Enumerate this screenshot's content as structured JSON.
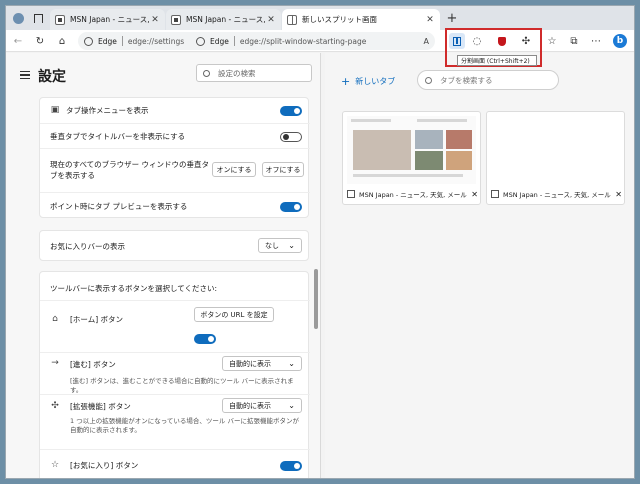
{
  "browser": {
    "tabs": [
      {
        "title": "MSN Japan - ニュース, 天気, メール",
        "active": false
      },
      {
        "title": "MSN Japan - ニュース, 天気, メール",
        "active": false
      },
      {
        "title": "新しいスプリット画面",
        "active": true
      }
    ],
    "new_tab_glyph": "+",
    "address": {
      "left": {
        "host": "Edge",
        "path": "edge://settings"
      },
      "right": {
        "host": "Edge",
        "path": "edge://split-window-starting-page"
      }
    },
    "tooltip": "分割画面 (Ctrl+Shift+2)"
  },
  "settings": {
    "title": "設定",
    "search_placeholder": "設定の検索",
    "tab_options": [
      {
        "label": "タブ操作メニューを表示",
        "state": "on"
      },
      {
        "label": "垂直タブでタイトルバーを非表示にする",
        "state": "off"
      },
      {
        "label": "現在のすべてのブラウザー ウィンドウの垂直タブを表示する",
        "buttons": [
          "オンにする",
          "オフにする"
        ]
      },
      {
        "label": "ポイント時にタブ プレビューを表示する",
        "state": "on"
      }
    ],
    "favorites_bar": {
      "label": "お気に入りバーの表示",
      "value": "なし"
    },
    "toolbar_section": {
      "heading": "ツールバーに表示するボタンを選択してください:",
      "items": [
        {
          "label": "[ホーム] ボタン",
          "button": "ボタンの URL を設定",
          "state": "on"
        },
        {
          "label": "[進む] ボタン",
          "value": "自動的に表示",
          "desc": "[進む] ボタンは、進むことができる場合に自動的にツール バーに表示されます。"
        },
        {
          "label": "[拡張機能] ボタン",
          "value": "自動的に表示",
          "desc": "1 つ以上の拡張機能がオンになっている場合、ツール バーに拡張機能ボタンが自動的に表示されます。"
        },
        {
          "label": "[お気に入り] ボタン",
          "state": "on"
        }
      ]
    }
  },
  "newtab": {
    "new_tab_label": "新しいタブ",
    "search_placeholder": "タブを検索する",
    "thumbnails": [
      {
        "title": "MSN Japan - ニュース, 天気, メール (..."
      },
      {
        "title": "MSN Japan - ニュース, 天気, メール (..."
      }
    ]
  },
  "colors": {
    "accent": "#0f6cbd",
    "highlight_box": "#d02b2b"
  }
}
